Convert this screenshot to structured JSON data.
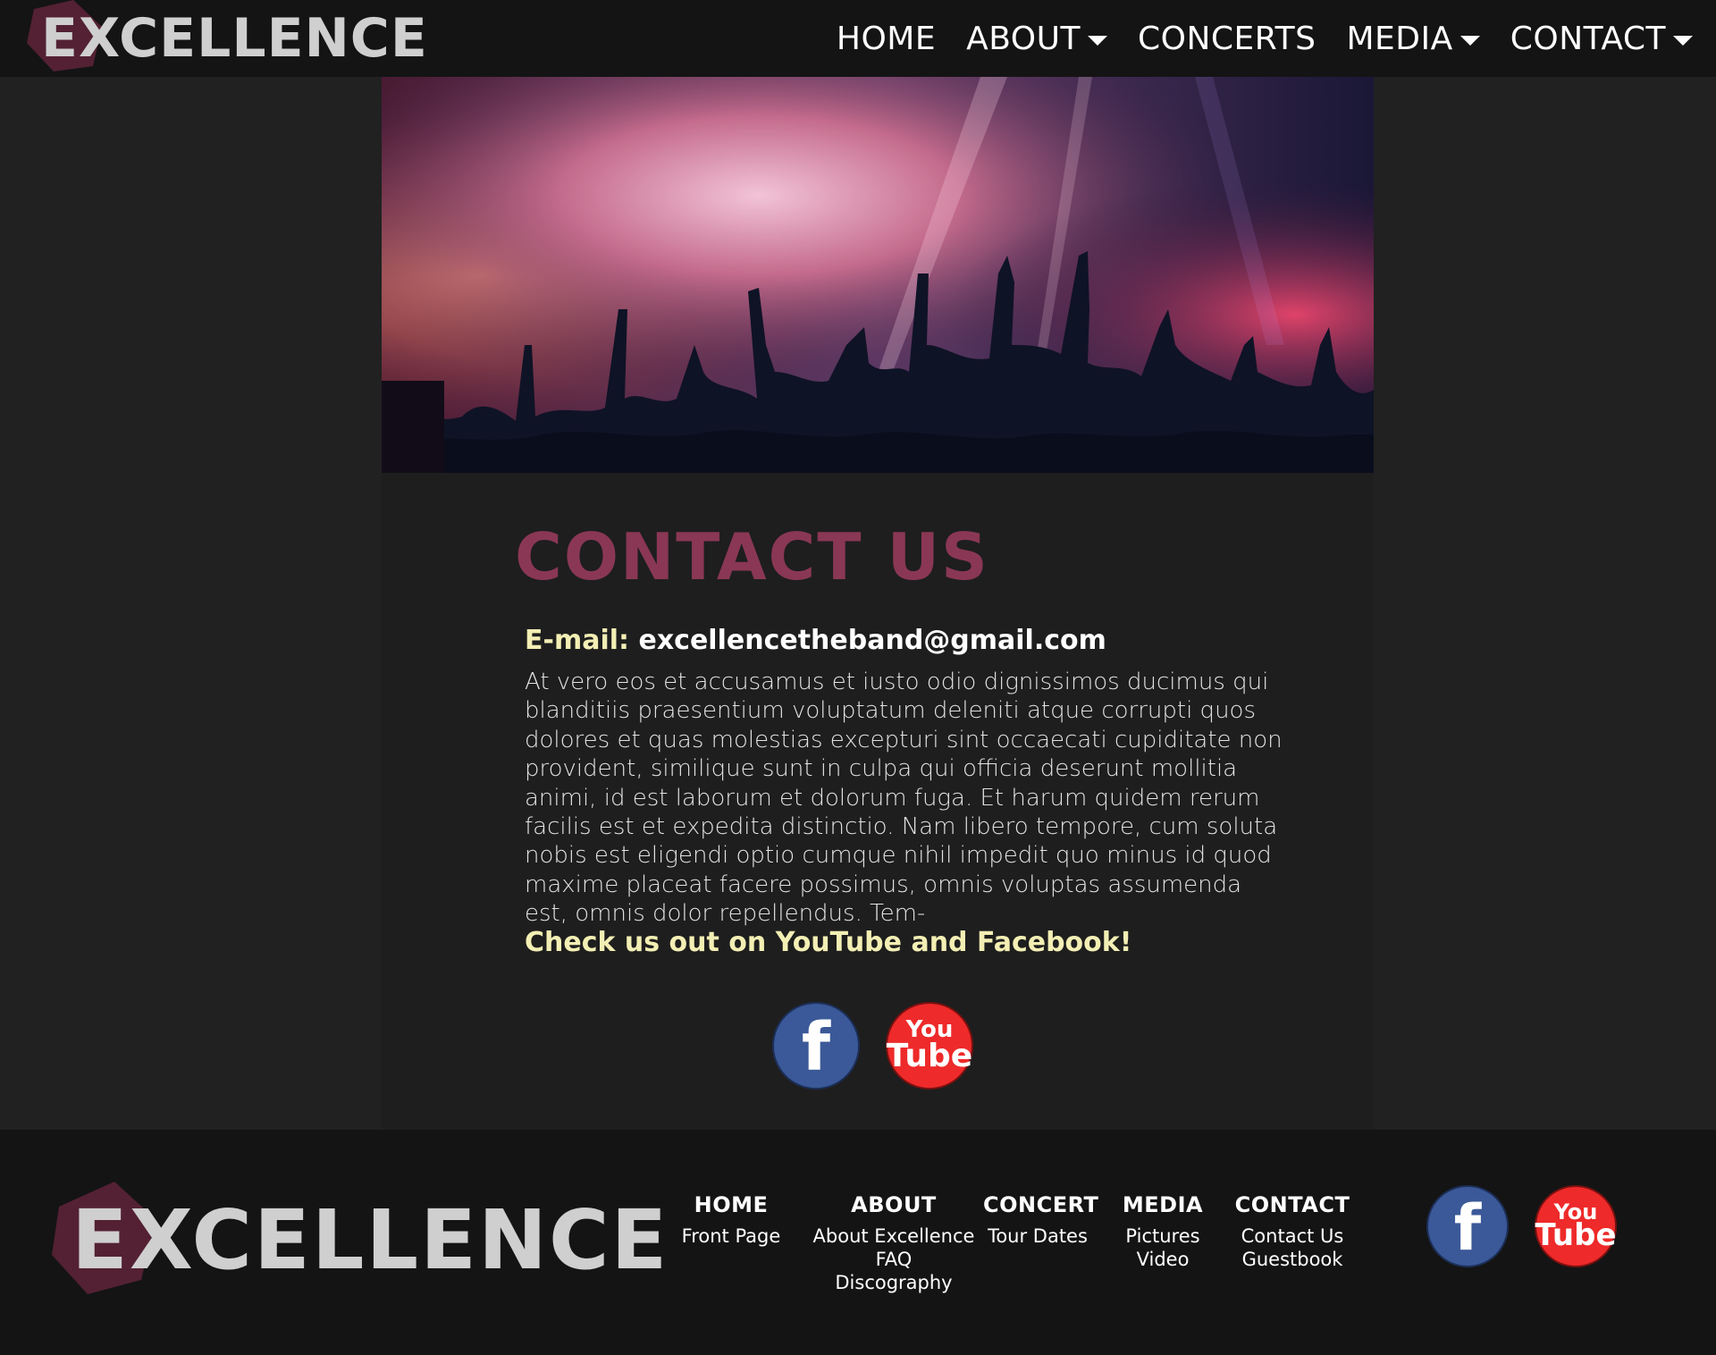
{
  "brand": {
    "name": "EXCELLENCE",
    "accent": "#8a3755",
    "highlight": "#f3efb4"
  },
  "nav": {
    "items": [
      {
        "label": "HOME",
        "has_dropdown": false
      },
      {
        "label": "ABOUT",
        "has_dropdown": true
      },
      {
        "label": "CONCERTS",
        "has_dropdown": false
      },
      {
        "label": "MEDIA",
        "has_dropdown": true
      },
      {
        "label": "CONTACT",
        "has_dropdown": true
      }
    ]
  },
  "hero": {
    "icon": "concert-crowd-photo"
  },
  "main": {
    "title": "CONTACT US",
    "email_label": "E-mail:",
    "email_value": "excellencetheband@gmail.com",
    "body": "At vero eos et accusamus et iusto odio dignissimos ducimus qui blanditiis praesentium voluptatum deleniti atque corrupti quos dolores et quas molestias excepturi sint occaecati cupiditate non provident, similique sunt in culpa qui officia deserunt mollitia animi, id est laborum et dolorum fuga. Et harum quidem rerum facilis est et expedita distinctio. Nam libero tempore, cum soluta nobis est eligendi optio cumque nihil impedit quo minus id quod maxime placeat facere possimus, omnis voluptas assumenda est, omnis dolor repellendus. Tem-",
    "cta": "Check us out on YouTube and Facebook!",
    "social": {
      "facebook_glyph": "f",
      "youtube_top": "You",
      "youtube_bottom": "Tube"
    }
  },
  "footer": {
    "columns": [
      {
        "heading": "HOME",
        "links": [
          "Front Page"
        ]
      },
      {
        "heading": "ABOUT",
        "links": [
          "About Excellence",
          "FAQ",
          "Discography"
        ]
      },
      {
        "heading": "CONCERT",
        "links": [
          "Tour Dates"
        ]
      },
      {
        "heading": "MEDIA",
        "links": [
          "Pictures",
          "Video"
        ]
      },
      {
        "heading": "CONTACT",
        "links": [
          "Contact Us",
          "Guestbook"
        ]
      }
    ],
    "social": {
      "facebook_glyph": "f",
      "youtube_top": "You",
      "youtube_bottom": "Tube"
    }
  }
}
